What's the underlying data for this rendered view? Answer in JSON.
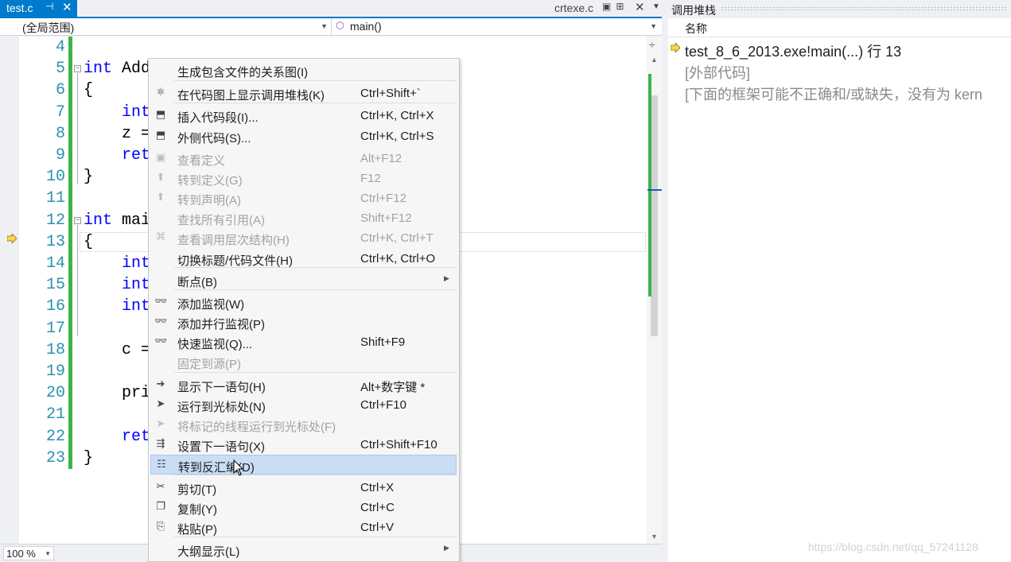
{
  "tabs": {
    "active": {
      "title": "test.c",
      "pin": "⊣",
      "close": "✕"
    },
    "other": {
      "title": "crtexe.c",
      "close": "✕"
    }
  },
  "navbar": {
    "scope": "(全局范围)",
    "member": "main()"
  },
  "editor": {
    "lines": [
      {
        "n": "4",
        "code": ""
      },
      {
        "n": "5",
        "kw": "int",
        "code": " Add"
      },
      {
        "n": "6",
        "code": "{"
      },
      {
        "n": "7",
        "kw": "int",
        "code": "",
        "indent": "    "
      },
      {
        "n": "8",
        "code": "    z ="
      },
      {
        "n": "9",
        "kw": "ret",
        "code": "",
        "indent": "    "
      },
      {
        "n": "10",
        "code": "}"
      },
      {
        "n": "11",
        "code": ""
      },
      {
        "n": "12",
        "kw": "int",
        "code": " mai"
      },
      {
        "n": "13",
        "code": "{"
      },
      {
        "n": "14",
        "kw": "int",
        "code": "",
        "indent": "    "
      },
      {
        "n": "15",
        "kw": "int",
        "code": "",
        "indent": "    "
      },
      {
        "n": "16",
        "kw": "int",
        "code": "",
        "indent": "    "
      },
      {
        "n": "17",
        "code": ""
      },
      {
        "n": "18",
        "code": "    c ="
      },
      {
        "n": "19",
        "code": ""
      },
      {
        "n": "20",
        "code": "    pri"
      },
      {
        "n": "21",
        "code": ""
      },
      {
        "n": "22",
        "kw": "ret",
        "code": "",
        "indent": "    "
      },
      {
        "n": "23",
        "code": "}"
      }
    ],
    "zoom": "100 %"
  },
  "callstack": {
    "title": "调用堆栈",
    "column_name": "名称",
    "rows": [
      "test_8_6_2013.exe!main(...) 行 13",
      "[外部代码]",
      "[下面的框架可能不正确和/或缺失，没有为 kern"
    ]
  },
  "context_menu": {
    "items": [
      {
        "label": "生成包含文件的关系图(I)",
        "shortcut": "",
        "icon": "none"
      },
      {
        "label": "在代码图上显示调用堆栈(K)",
        "shortcut": "Ctrl+Shift+`",
        "icon": "code-map-icon"
      },
      {
        "label": "插入代码段(I)...",
        "shortcut": "Ctrl+K, Ctrl+X",
        "icon": "snippet-icon"
      },
      {
        "label": "外侧代码(S)...",
        "shortcut": "Ctrl+K, Ctrl+S",
        "icon": "surround-icon"
      },
      {
        "label": "查看定义",
        "shortcut": "Alt+F12",
        "icon": "peek-icon",
        "disabled": true
      },
      {
        "label": "转到定义(G)",
        "shortcut": "F12",
        "icon": "goto-def-icon",
        "disabled": true
      },
      {
        "label": "转到声明(A)",
        "shortcut": "Ctrl+F12",
        "icon": "goto-decl-icon",
        "disabled": true
      },
      {
        "label": "查找所有引用(A)",
        "shortcut": "Shift+F12",
        "icon": "none",
        "disabled": true
      },
      {
        "label": "查看调用层次结构(H)",
        "shortcut": "Ctrl+K, Ctrl+T",
        "icon": "hierarchy-icon",
        "disabled": true
      },
      {
        "label": "切换标题/代码文件(H)",
        "shortcut": "Ctrl+K, Ctrl+O",
        "icon": "none"
      },
      {
        "label": "断点(B)",
        "shortcut": "",
        "icon": "none",
        "submenu": true
      },
      {
        "label": "添加监视(W)",
        "shortcut": "",
        "icon": "glasses-icon"
      },
      {
        "label": "添加并行监视(P)",
        "shortcut": "",
        "icon": "glasses-icon"
      },
      {
        "label": "快速监视(Q)...",
        "shortcut": "Shift+F9",
        "icon": "glasses-icon"
      },
      {
        "label": "固定到源(P)",
        "shortcut": "",
        "icon": "none",
        "disabled": true
      },
      {
        "label": "显示下一语句(H)",
        "shortcut": "Alt+数字键 *",
        "icon": "arrow-right-icon"
      },
      {
        "label": "运行到光标处(N)",
        "shortcut": "Ctrl+F10",
        "icon": "pointer-icon"
      },
      {
        "label": "将标记的线程运行到光标处(F)",
        "shortcut": "",
        "icon": "pointer-icon",
        "disabled": true
      },
      {
        "label": "设置下一语句(X)",
        "shortcut": "Ctrl+Shift+F10",
        "icon": "set-next-icon"
      },
      {
        "label": "转到反汇编(D)",
        "shortcut": "",
        "icon": "disassembly-icon",
        "highlighted": true
      },
      {
        "label": "剪切(T)",
        "shortcut": "Ctrl+X",
        "icon": "scissors-icon"
      },
      {
        "label": "复制(Y)",
        "shortcut": "Ctrl+C",
        "icon": "copy-icon"
      },
      {
        "label": "粘贴(P)",
        "shortcut": "Ctrl+V",
        "icon": "paste-icon"
      },
      {
        "label": "大纲显示(L)",
        "shortcut": "",
        "icon": "none",
        "submenu": true
      }
    ]
  },
  "watermark": "https://blog.csdn.net/qq_57241128"
}
